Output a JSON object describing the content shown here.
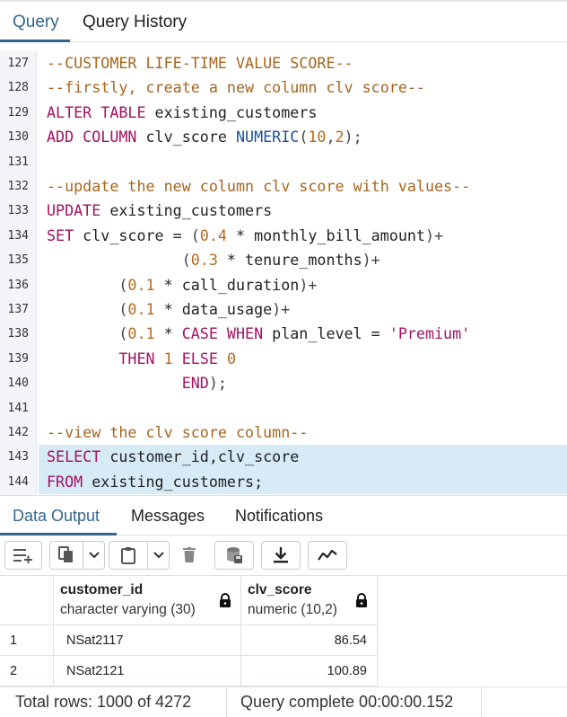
{
  "query_tabs": [
    {
      "label": "Query",
      "active": true
    },
    {
      "label": "Query History",
      "active": false
    }
  ],
  "editor": {
    "lines": [
      {
        "n": "127",
        "tokens": [
          {
            "t": "--CUSTOMER LIFE-TIME VALUE SCORE--",
            "c": "cmt"
          }
        ]
      },
      {
        "n": "128",
        "tokens": [
          {
            "t": "--firstly, create a new column clv score--",
            "c": "cmt"
          }
        ]
      },
      {
        "n": "129",
        "tokens": [
          {
            "t": "ALTER TABLE",
            "c": "kw"
          },
          {
            "t": " existing_customers",
            "c": ""
          }
        ]
      },
      {
        "n": "130",
        "tokens": [
          {
            "t": "ADD COLUMN",
            "c": "kw"
          },
          {
            "t": " clv_score ",
            "c": ""
          },
          {
            "t": "NUMERIC",
            "c": "typ"
          },
          {
            "t": "(",
            "c": "op"
          },
          {
            "t": "10",
            "c": "num"
          },
          {
            "t": ",",
            "c": "op"
          },
          {
            "t": "2",
            "c": "num"
          },
          {
            "t": ");",
            "c": "op"
          }
        ]
      },
      {
        "n": "131",
        "tokens": []
      },
      {
        "n": "132",
        "tokens": [
          {
            "t": "--update the new column clv score with values--",
            "c": "cmt"
          }
        ]
      },
      {
        "n": "133",
        "tokens": [
          {
            "t": "UPDATE",
            "c": "kw"
          },
          {
            "t": " existing_customers",
            "c": ""
          }
        ]
      },
      {
        "n": "134",
        "tokens": [
          {
            "t": "SET",
            "c": "kw"
          },
          {
            "t": " clv_score = ",
            "c": ""
          },
          {
            "t": "(",
            "c": "op"
          },
          {
            "t": "0.4",
            "c": "num"
          },
          {
            "t": " * monthly_bill_amount",
            "c": ""
          },
          {
            "t": ")+",
            "c": "op"
          }
        ]
      },
      {
        "n": "135",
        "tokens": [
          {
            "t": "               ",
            "c": ""
          },
          {
            "t": "(",
            "c": "op"
          },
          {
            "t": "0.3",
            "c": "num"
          },
          {
            "t": " * tenure_months",
            "c": ""
          },
          {
            "t": ")+",
            "c": "op"
          }
        ]
      },
      {
        "n": "136",
        "tokens": [
          {
            "t": "        ",
            "c": ""
          },
          {
            "t": "(",
            "c": "op"
          },
          {
            "t": "0.1",
            "c": "num"
          },
          {
            "t": " * call_duration",
            "c": ""
          },
          {
            "t": ")+",
            "c": "op"
          }
        ]
      },
      {
        "n": "137",
        "tokens": [
          {
            "t": "        ",
            "c": ""
          },
          {
            "t": "(",
            "c": "op"
          },
          {
            "t": "0.1",
            "c": "num"
          },
          {
            "t": " * data_usage",
            "c": ""
          },
          {
            "t": ")+",
            "c": "op"
          }
        ]
      },
      {
        "n": "138",
        "tokens": [
          {
            "t": "        ",
            "c": ""
          },
          {
            "t": "(",
            "c": "op"
          },
          {
            "t": "0.1",
            "c": "num"
          },
          {
            "t": " * ",
            "c": ""
          },
          {
            "t": "CASE WHEN",
            "c": "kw"
          },
          {
            "t": " plan_level = ",
            "c": ""
          },
          {
            "t": "'Premium'",
            "c": "str"
          }
        ]
      },
      {
        "n": "139",
        "tokens": [
          {
            "t": "        ",
            "c": ""
          },
          {
            "t": "THEN",
            "c": "kw"
          },
          {
            "t": " ",
            "c": ""
          },
          {
            "t": "1",
            "c": "num"
          },
          {
            "t": " ",
            "c": ""
          },
          {
            "t": "ELSE",
            "c": "kw"
          },
          {
            "t": " ",
            "c": ""
          },
          {
            "t": "0",
            "c": "num"
          }
        ]
      },
      {
        "n": "140",
        "tokens": [
          {
            "t": "               ",
            "c": ""
          },
          {
            "t": "END",
            "c": "kw"
          },
          {
            "t": ");",
            "c": "op"
          }
        ]
      },
      {
        "n": "141",
        "tokens": []
      },
      {
        "n": "142",
        "tokens": [
          {
            "t": "--view the clv score column--",
            "c": "cmt"
          }
        ]
      },
      {
        "n": "143",
        "highlight": true,
        "tokens": [
          {
            "t": "SELECT",
            "c": "kw"
          },
          {
            "t": " customer_id,clv_score",
            "c": ""
          }
        ]
      },
      {
        "n": "144",
        "highlight": true,
        "tokens": [
          {
            "t": "FROM",
            "c": "kw"
          },
          {
            "t": " existing_customers;",
            "c": ""
          }
        ]
      }
    ]
  },
  "output_tabs": [
    {
      "label": "Data Output",
      "active": true
    },
    {
      "label": "Messages",
      "active": false
    },
    {
      "label": "Notifications",
      "active": false
    }
  ],
  "toolbar": {
    "buttons": [
      "add-row-icon",
      "copy-icon",
      "paste-icon",
      "delete-icon",
      "save-data-icon",
      "download-icon",
      "graph-icon"
    ]
  },
  "grid": {
    "columns": [
      {
        "name": "customer_id",
        "type": "character varying (30)"
      },
      {
        "name": "clv_score",
        "type": "numeric (10,2)"
      }
    ],
    "rows": [
      {
        "n": "1",
        "customer_id": "NSat2117",
        "clv_score": "86.54"
      },
      {
        "n": "2",
        "customer_id": "NSat2121",
        "clv_score": "100.89"
      }
    ]
  },
  "status": {
    "total_rows": "Total rows: 1000 of 4272",
    "query_complete": "Query complete 00:00:00.152"
  },
  "colors": {
    "accent": "#326690",
    "keyword": "#a31162",
    "comment": "#a6651f",
    "highlight": "#d6ebf6"
  }
}
